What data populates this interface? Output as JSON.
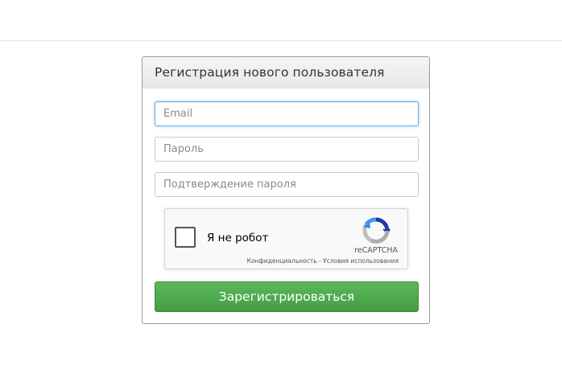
{
  "form": {
    "heading": "Регистрация нового пользователя",
    "email_placeholder": "Email",
    "password_placeholder": "Пароль",
    "confirm_placeholder": "Подтверждение пароля",
    "submit_label": "Зарегистрироваться"
  },
  "recaptcha": {
    "label": "Я не робот",
    "brand": "reCAPTCHA",
    "privacy": "Конфиденциальность",
    "separator": " - ",
    "terms": "Условия использования",
    "logo_icon": "recaptcha-logo-icon"
  },
  "colors": {
    "primary_button": "#5cb85c",
    "focus_border": "#66afe9"
  }
}
